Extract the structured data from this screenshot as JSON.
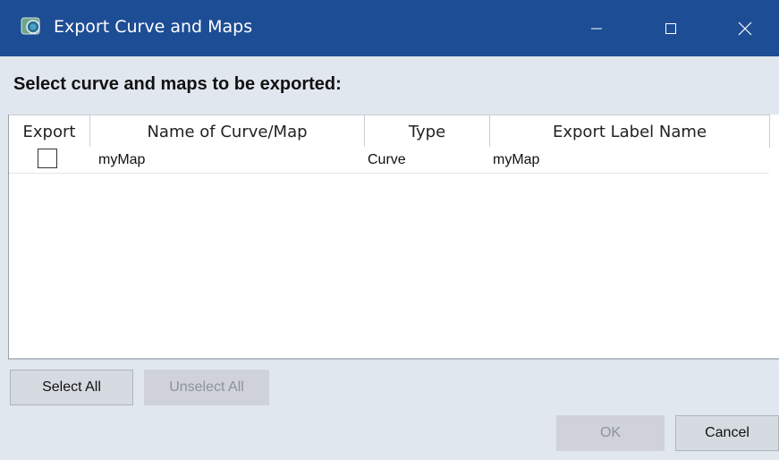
{
  "window": {
    "title": "Export Curve and Maps",
    "controls": {
      "minimize_icon": "minimize-icon",
      "maximize_icon": "maximize-icon",
      "close_icon": "close-icon"
    },
    "accent": "#1d4d94"
  },
  "heading": "Select curve and maps to be exported:",
  "table": {
    "columns": [
      "Export",
      "Name of Curve/Map",
      "Type",
      "Export Label Name"
    ],
    "rows": [
      {
        "export": false,
        "name": "myMap",
        "type": "Curve",
        "label": "myMap"
      }
    ]
  },
  "buttons": {
    "select_all": "Select All",
    "unselect_all": "Unselect All",
    "ok": "OK",
    "cancel": "Cancel"
  }
}
